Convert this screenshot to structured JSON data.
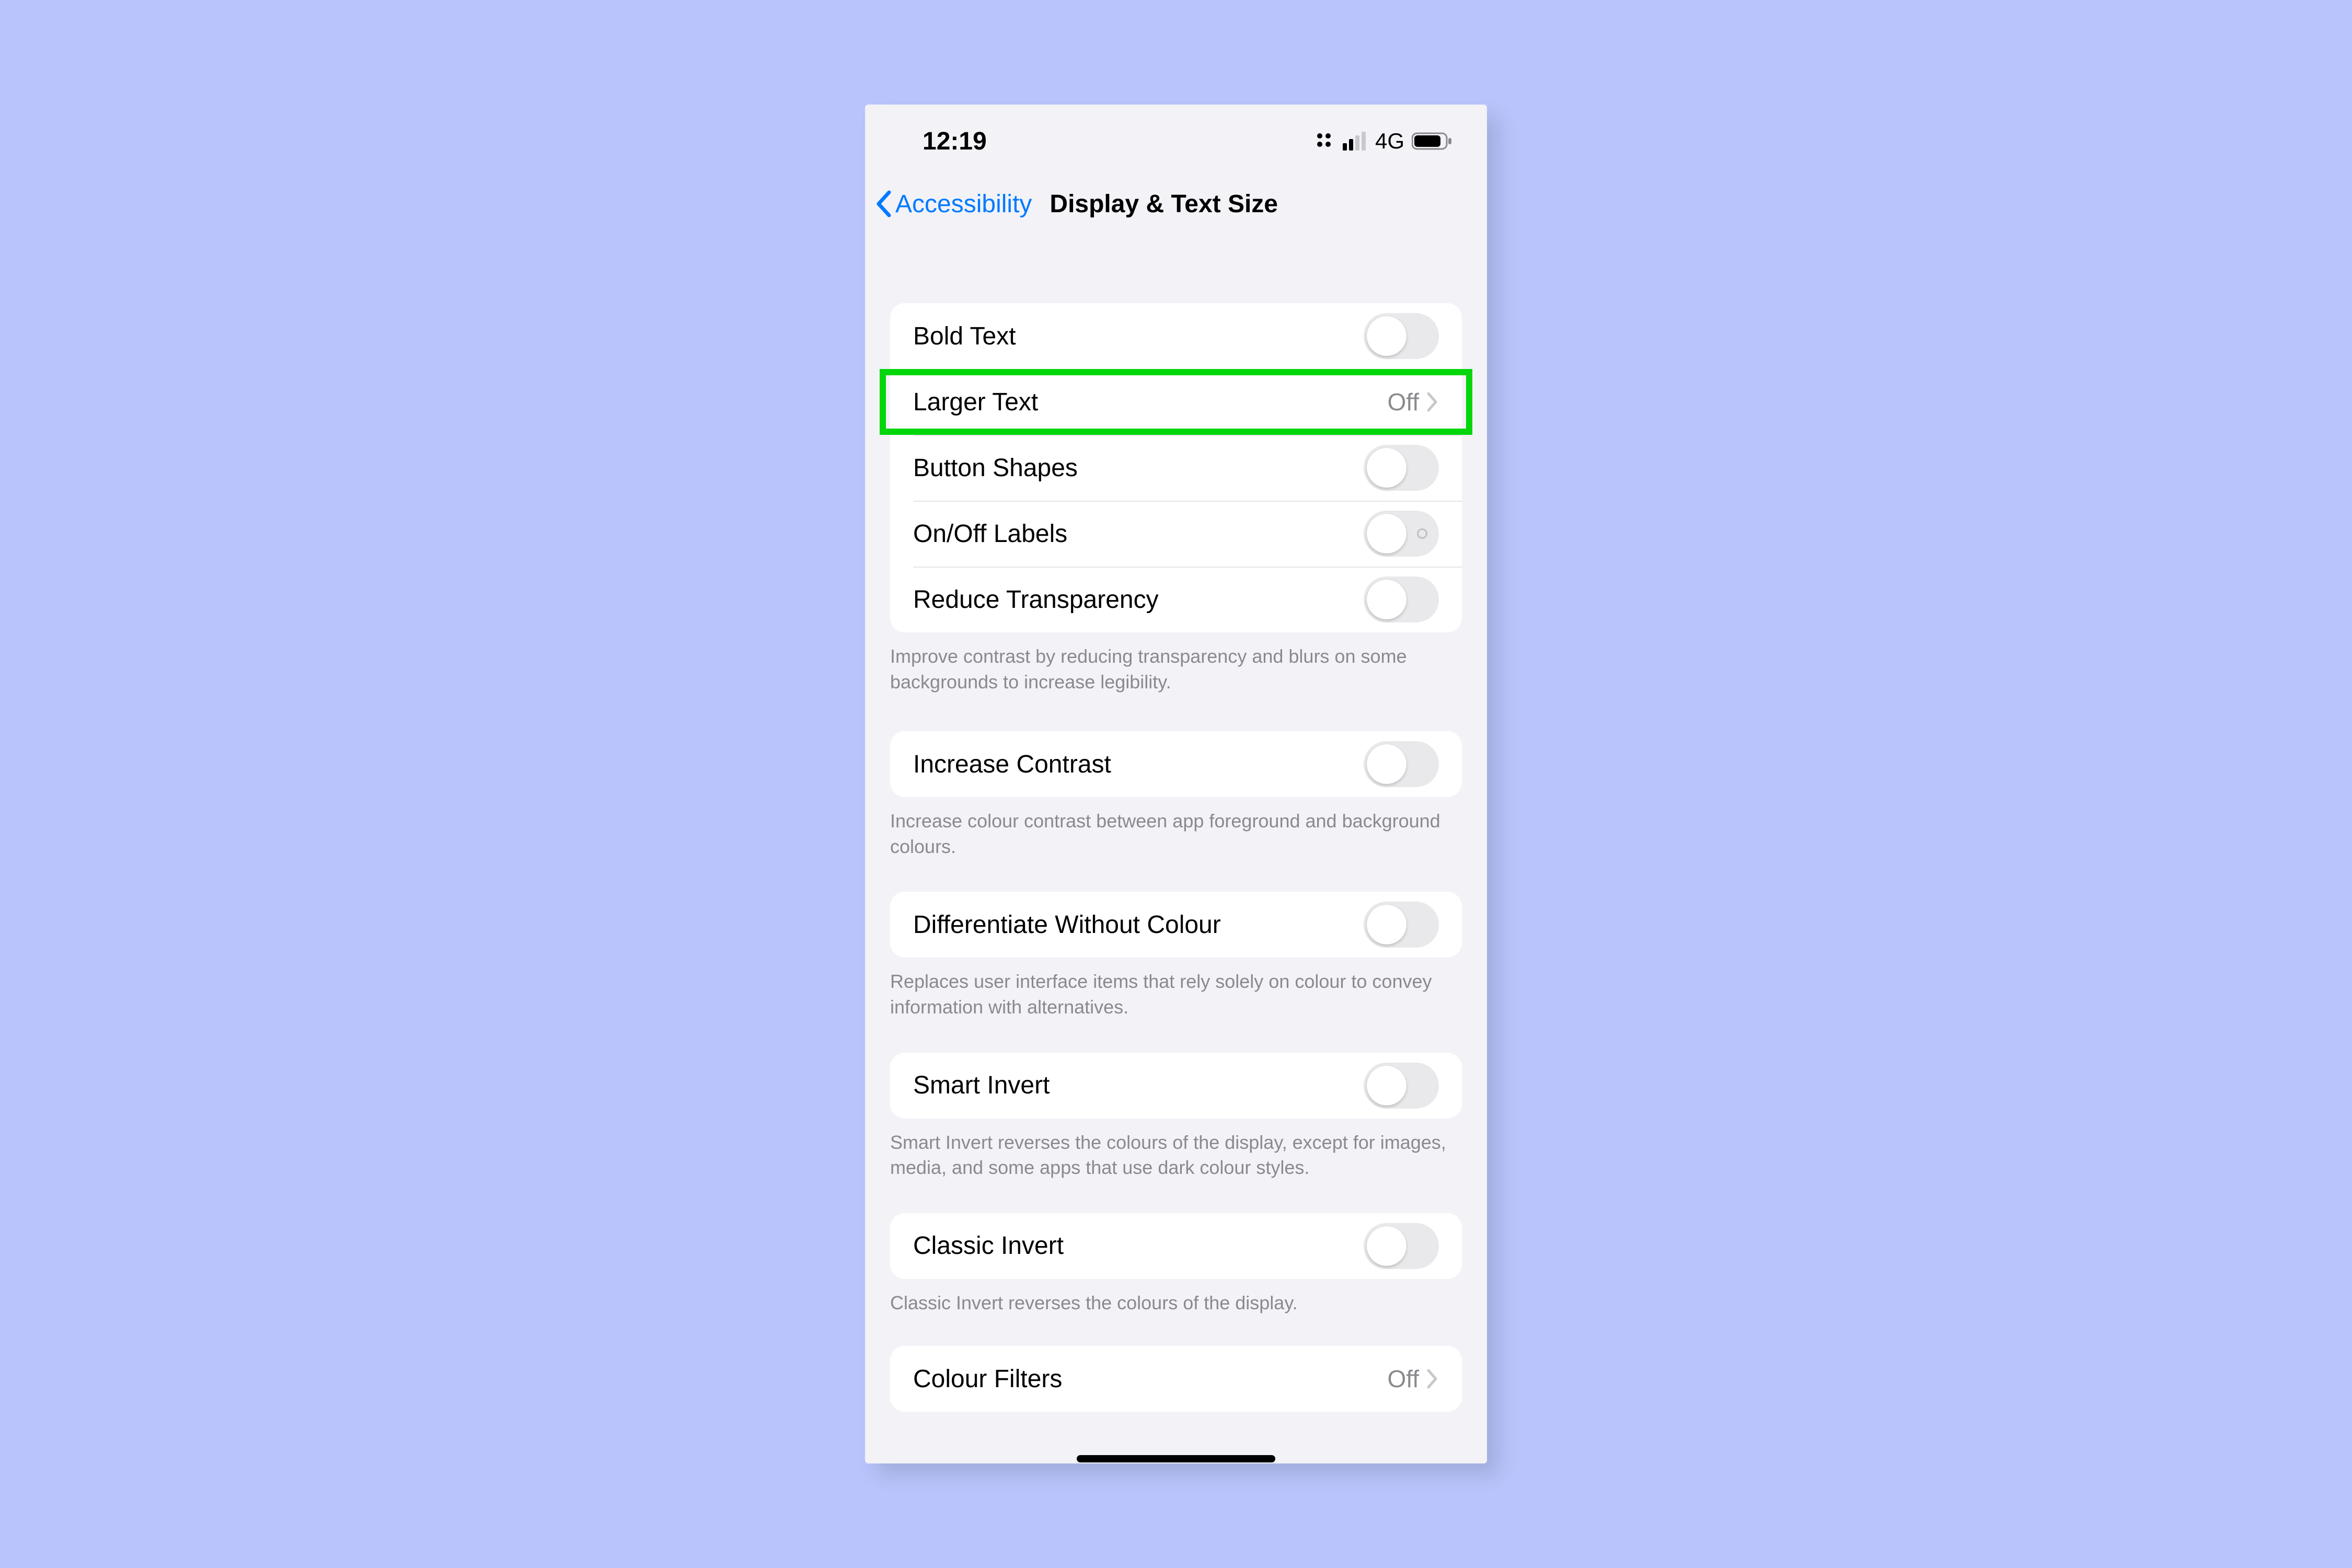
{
  "status": {
    "time": "12:19",
    "network": "4G"
  },
  "nav": {
    "back_label": "Accessibility",
    "title": "Display & Text Size"
  },
  "group1": {
    "bold_text": "Bold Text",
    "larger_text": "Larger Text",
    "larger_text_value": "Off",
    "button_shapes": "Button Shapes",
    "on_off_labels": "On/Off Labels",
    "reduce_transparency": "Reduce Transparency",
    "footer": "Improve contrast by reducing transparency and blurs on some backgrounds to increase legibility."
  },
  "group2": {
    "increase_contrast": "Increase Contrast",
    "footer": "Increase colour contrast between app foreground and background colours."
  },
  "group3": {
    "differentiate": "Differentiate Without Colour",
    "footer": "Replaces user interface items that rely solely on colour to convey information with alternatives."
  },
  "group4": {
    "smart_invert": "Smart Invert",
    "footer": "Smart Invert reverses the colours of the display, except for images, media, and some apps that use dark colour styles."
  },
  "group5": {
    "classic_invert": "Classic Invert",
    "footer": "Classic Invert reverses the colours of the display."
  },
  "group6": {
    "colour_filters": "Colour Filters",
    "colour_filters_value": "Off"
  }
}
